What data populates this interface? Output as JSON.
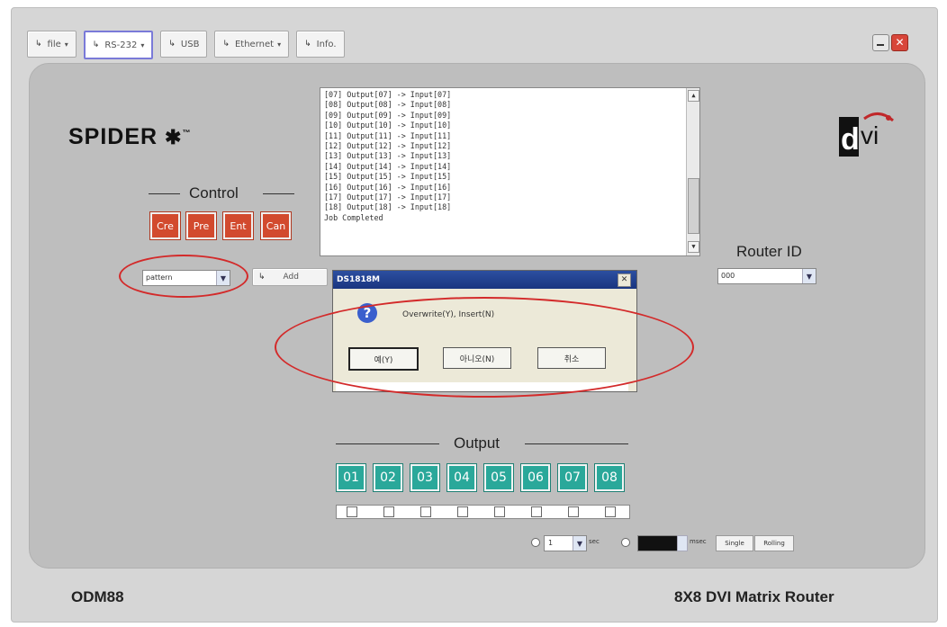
{
  "toolbar": {
    "file": "file",
    "rs232": "RS-232",
    "usb": "USB",
    "ethernet": "Ethernet",
    "info": "Info."
  },
  "brand": {
    "logo": "SPIDER",
    "logo_mark": "™"
  },
  "control": {
    "title": "Control",
    "buttons": [
      "Cre",
      "Pre",
      "Ent",
      "Can"
    ]
  },
  "log": {
    "lines": [
      "[07] Output[07] -> Input[07]",
      "[08] Output[08] -> Input[08]",
      "[09] Output[09] -> Input[09]",
      "[10] Output[10] -> Input[10]",
      "[11] Output[11] -> Input[11]",
      "[12] Output[12] -> Input[12]",
      "[13] Output[13] -> Input[13]",
      "[14] Output[14] -> Input[14]",
      "[15] Output[15] -> Input[15]",
      "[16] Output[16] -> Input[16]",
      "[17] Output[17] -> Input[17]",
      "[18] Output[18] -> Input[18]",
      "Job Completed"
    ]
  },
  "pattern_select": {
    "value": "pattern"
  },
  "add_button": "Add",
  "router": {
    "title": "Router ID",
    "value": "000"
  },
  "dialog": {
    "title": "DS1818M",
    "message": "Overwrite(Y), Insert(N)",
    "yes": "예(Y)",
    "no": "아니오(N)",
    "cancel": "취소"
  },
  "output": {
    "title": "Output",
    "buttons": [
      "01",
      "02",
      "03",
      "04",
      "05",
      "06",
      "07",
      "08"
    ]
  },
  "timing": {
    "seconds_value": "1",
    "sec_label": "sec",
    "msec_label": "msec",
    "single": "Single",
    "rolling": "Rolling"
  },
  "footer": {
    "model": "ODM88",
    "product": "8X8 DVI Matrix Router"
  },
  "colors": {
    "accent_red": "#d24a2e",
    "output_teal": "#2aa89a",
    "annotation_red": "#d32a2a"
  }
}
